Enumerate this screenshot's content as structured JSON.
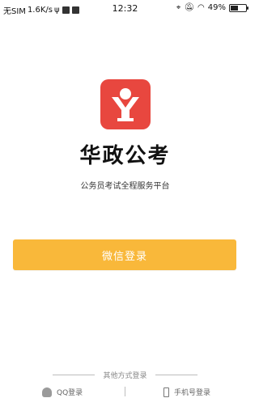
{
  "status_bar": {
    "carrier": "无SIM",
    "speed": "1.6K/s",
    "time": "12:32",
    "battery": "49%",
    "battery_level": 0.49
  },
  "app": {
    "name": "华政公考",
    "slogan": "公务员考试全程服务平台",
    "logo_color": "#e8473f"
  },
  "login": {
    "wechat_label": "微信登录",
    "wechat_color": "#f9b83a",
    "other_methods_label": "其他方式登录",
    "qq_label": "QQ登录",
    "phone_label": "手机号登录"
  }
}
